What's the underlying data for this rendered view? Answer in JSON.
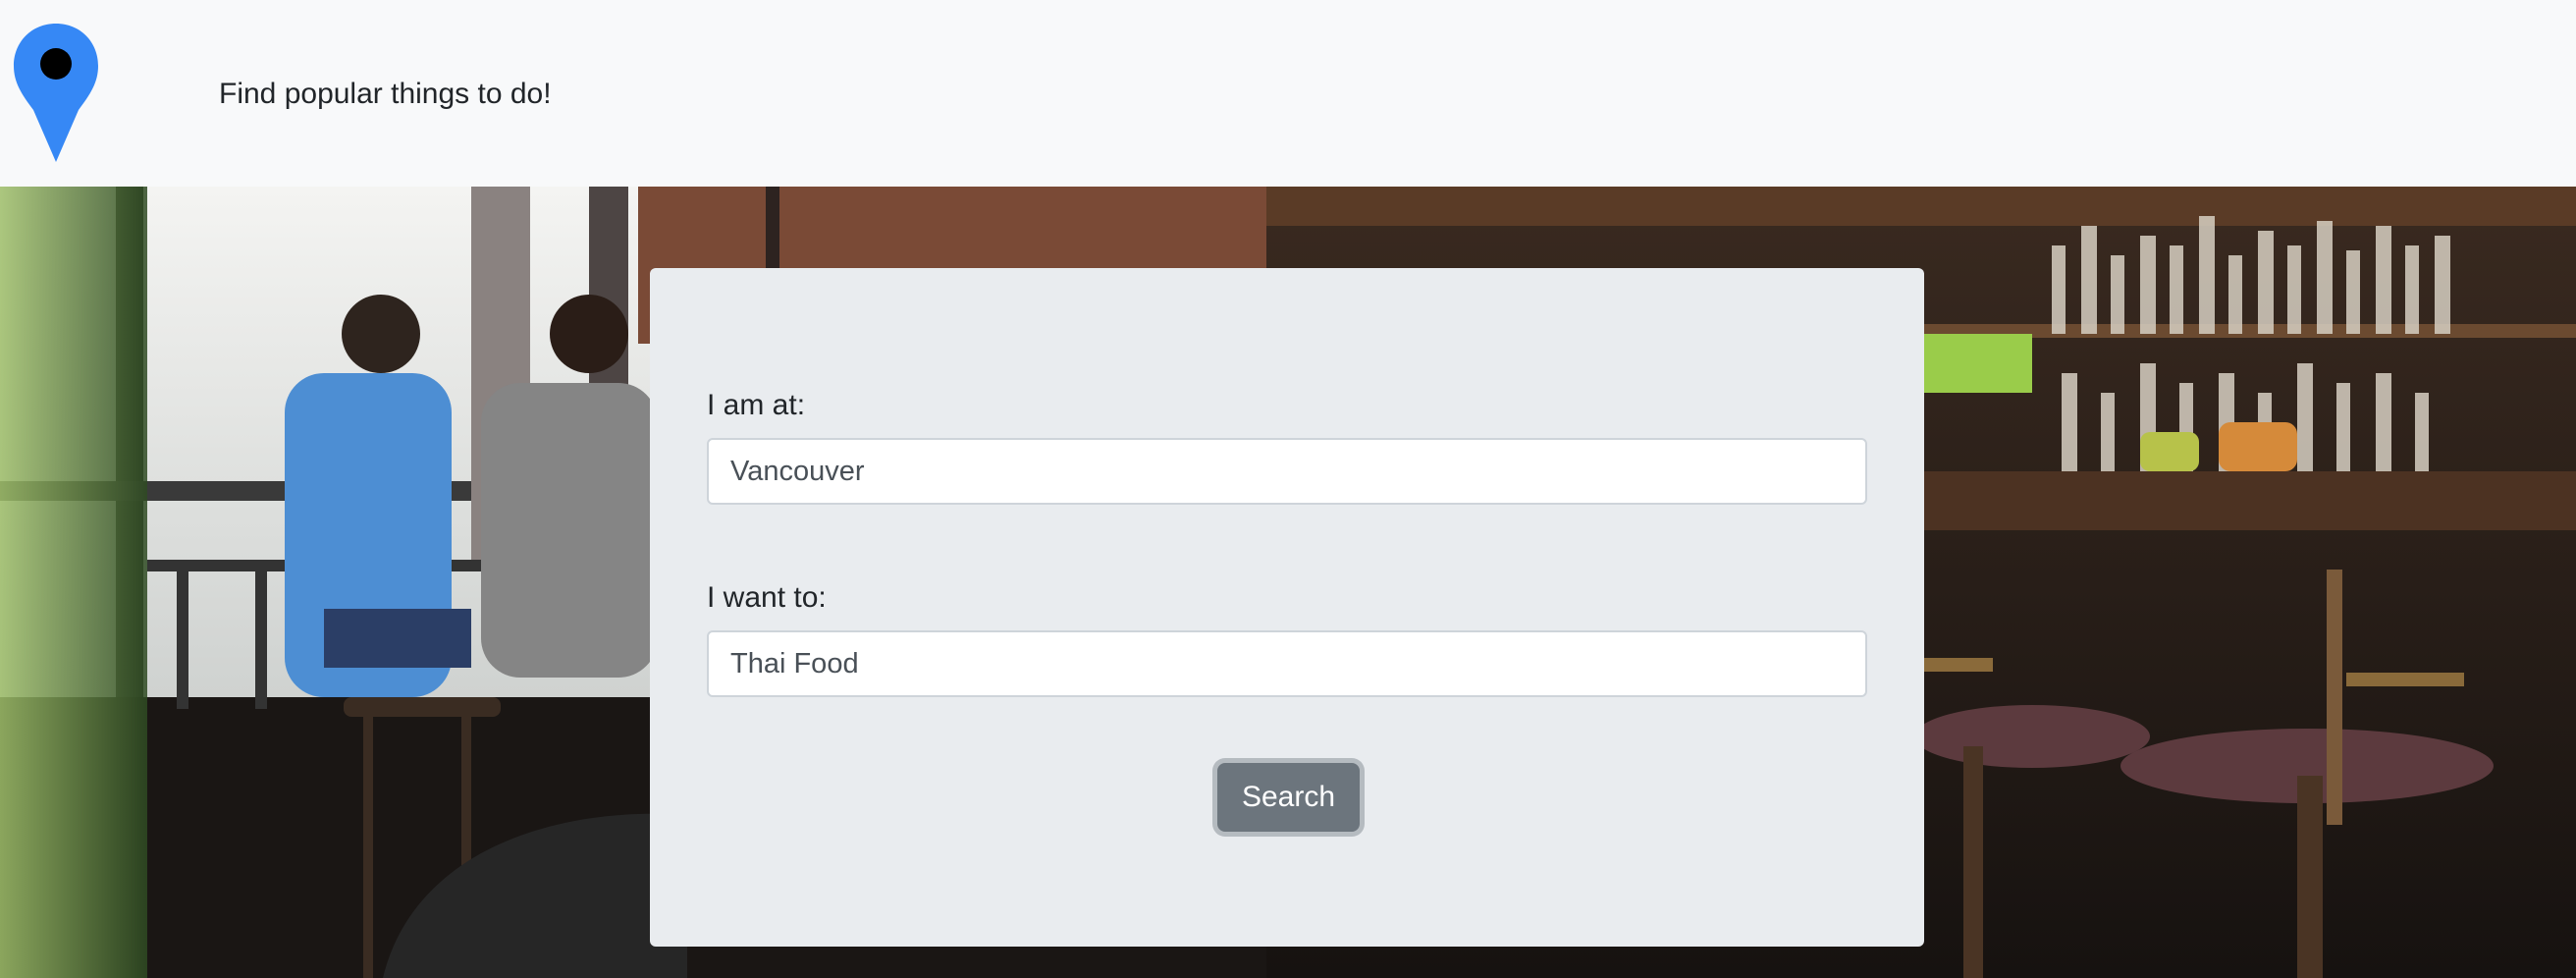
{
  "header": {
    "logo_icon": "map-pin-icon",
    "logo_color": "#3688f5",
    "tagline": "Find popular things to do!"
  },
  "search_form": {
    "location_label": "I am at:",
    "location_value": "Vancouver",
    "activity_label": "I want to:",
    "activity_value": "Thai Food",
    "search_button_label": "Search"
  }
}
